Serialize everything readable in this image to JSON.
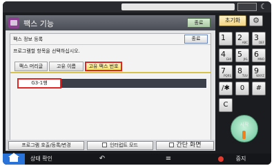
{
  "app": {
    "title": "팩스 기능",
    "header_button": "종료"
  },
  "dialog": {
    "title": "팩스 정보 등록",
    "close_button": "종료",
    "instruction": "프로그램할 항목을 선택하십시오.",
    "tabs": [
      {
        "label": "팩스 머리글",
        "selected": false
      },
      {
        "label": "고유 이름",
        "selected": false
      },
      {
        "label": "고유 팩스 번호",
        "selected": true
      }
    ],
    "selected_field": "G3-1행"
  },
  "footer": {
    "program_button": "프로그램 호출/등록/변경",
    "interrupt_button": "인터럽트 모드",
    "simple_screen_button": "간단 화면"
  },
  "keypad": {
    "reset_label": "초기화",
    "gear_icon": "gear-icon",
    "keys": [
      {
        "num": "1",
        "sub": ""
      },
      {
        "num": "2",
        "sub": "ABC"
      },
      {
        "num": "3",
        "sub": "DEF"
      },
      {
        "num": "4",
        "sub": "GHI"
      },
      {
        "num": "5",
        "sub": "JKL"
      },
      {
        "num": "6",
        "sub": "MNO"
      },
      {
        "num": "7",
        "sub": "PQRS"
      },
      {
        "num": "8",
        "sub": "TUV"
      },
      {
        "num": "9",
        "sub": "WXYZ"
      },
      {
        "num": "/✱",
        "sub": ""
      },
      {
        "num": "0",
        "sub": ""
      },
      {
        "num": "#",
        "sub": ""
      },
      {
        "num": "C",
        "sub": ""
      }
    ],
    "start_label": "시작"
  },
  "bottombar": {
    "status_label": "상태 확인",
    "back_icon": "↶",
    "menu_icon": "≡",
    "stop_label": "중지"
  },
  "colors": {
    "highlight": "#e32424",
    "tab_selected": "#f3df6b",
    "home_blue": "#2a73d9",
    "start_green": "#6bc59b",
    "stop_red": "#e23a2d"
  }
}
